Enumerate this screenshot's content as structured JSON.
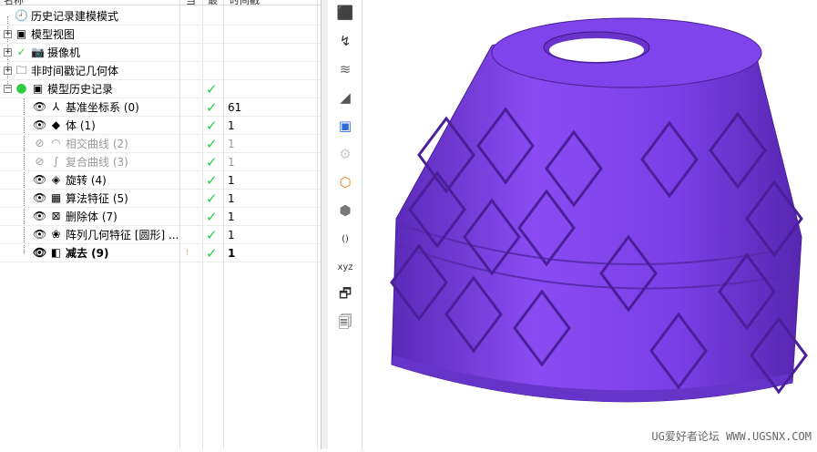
{
  "header": {
    "columns": [
      "名称",
      "当",
      "最",
      "时间戳"
    ]
  },
  "tree": [
    {
      "label": "历史记录建模模式",
      "icon": "clock-icon",
      "check": false,
      "value": "",
      "style": "normal",
      "indent": 0,
      "expander": ""
    },
    {
      "label": "模型视图",
      "icon": "model-view-icon",
      "check": false,
      "value": "",
      "style": "normal",
      "indent": 0,
      "expander": "+"
    },
    {
      "label": "摄像机",
      "icon": "camera-icon",
      "check": false,
      "value": "",
      "style": "normal",
      "indent": 0,
      "expander": "+"
    },
    {
      "label": "非时间戳记几何体",
      "icon": "folder-icon",
      "check": false,
      "value": "",
      "style": "normal",
      "indent": 0,
      "expander": "+"
    },
    {
      "label": "模型历史记录",
      "icon": "history-icon",
      "check": true,
      "value": "",
      "style": "normal",
      "indent": 0,
      "expander": "−"
    },
    {
      "label": "基准坐标系 (0)",
      "icon": "datum-csys-icon",
      "check": true,
      "value": "61",
      "style": "normal",
      "indent": 1
    },
    {
      "label": "体 (1)",
      "icon": "body-icon",
      "check": true,
      "value": "1",
      "style": "normal",
      "indent": 1
    },
    {
      "label": "相交曲线 (2)",
      "icon": "intersection-curve-icon",
      "check": true,
      "value": "1",
      "style": "gray",
      "indent": 1
    },
    {
      "label": "复合曲线 (3)",
      "icon": "composite-curve-icon",
      "check": true,
      "value": "1",
      "style": "gray",
      "indent": 1
    },
    {
      "label": "旋转 (4)",
      "icon": "revolve-icon",
      "check": true,
      "value": "1",
      "style": "normal",
      "indent": 1
    },
    {
      "label": "算法特征 (5)",
      "icon": "algorithm-feature-icon",
      "check": true,
      "value": "1",
      "style": "normal",
      "indent": 1
    },
    {
      "label": "删除体 (7)",
      "icon": "delete-body-icon",
      "check": true,
      "value": "1",
      "style": "normal",
      "indent": 1
    },
    {
      "label": "阵列几何特征 [圆形] ...",
      "icon": "pattern-geometry-icon",
      "check": true,
      "value": "1",
      "style": "normal",
      "indent": 1
    },
    {
      "label": "减去 (9)",
      "icon": "subtract-icon",
      "check": true,
      "value": "1",
      "style": "bold",
      "indent": 1
    }
  ],
  "toolbar": [
    "part-navigator-icon",
    "view-visibility-icon",
    "surface-icon",
    "section-icon",
    "constraint-icon",
    "assembly-icon",
    "wcs-box-icon",
    "csys-solid-icon",
    "coordinate-icon",
    "xyz-axes-icon",
    "layer-edit-icon",
    "layer-copy-icon"
  ],
  "viewport": {
    "watermark": "UG爱好者论坛 WWW.UGSNX.COM",
    "model_color": "#7a3fe6"
  }
}
